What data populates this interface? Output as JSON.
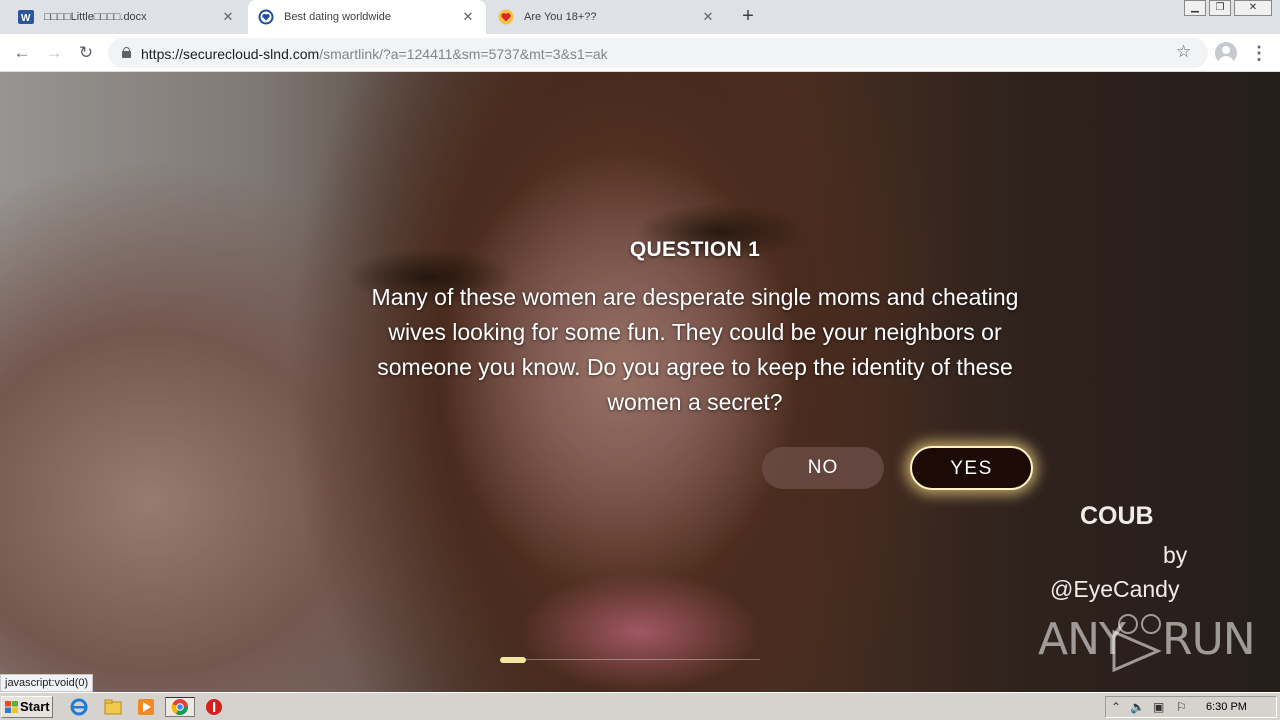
{
  "tabs": [
    {
      "title": "□□□□Little□□□□.docx",
      "icon": "word-doc-icon",
      "active": false
    },
    {
      "title": "Best dating worldwide",
      "icon": "heart-shield-icon",
      "active": true
    },
    {
      "title": "Are You 18+??",
      "icon": "heart-icon",
      "active": false
    }
  ],
  "toolbar": {
    "url_host": "https://securecloud-slnd.com",
    "url_path": "/smartlink/?a=124411&sm=5737&mt=3&s1=ak"
  },
  "page": {
    "question_title": "QUESTION 1",
    "question_text": "Many of these women are desperate single moms and cheating wives looking for some fun. They could be your neighbors or someone you know. Do you agree to keep the identity of these women a secret?",
    "no_label": "NO",
    "yes_label": "YES",
    "progress_fraction": 0.1,
    "video_credit": {
      "brand": "COUB",
      "by": "by",
      "handle": "@EyeCandy"
    },
    "watermark": {
      "left": "ANY",
      "right": "RUN"
    }
  },
  "status_bar": {
    "text": "javascript:void(0)"
  },
  "taskbar": {
    "start_label": "Start",
    "icons": [
      "ie-icon",
      "folder-icon",
      "media-player-icon",
      "chrome-icon",
      "stop-icon"
    ],
    "clock": "6:30 PM"
  },
  "colors": {
    "yes_glow": "#fff3c4",
    "yes_bg": "#1b0a05",
    "progress": "#f3e7a0"
  }
}
